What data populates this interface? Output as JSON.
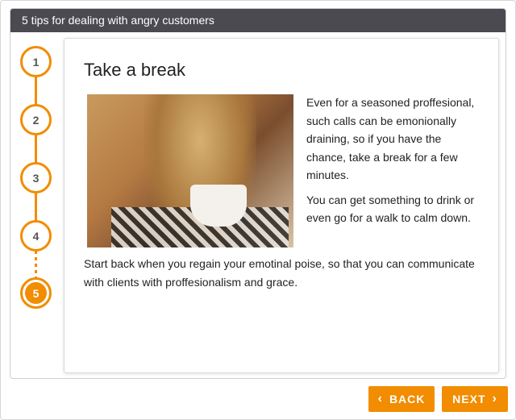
{
  "window": {
    "title": "5 tips for dealing with angry customers"
  },
  "steps": [
    {
      "label": "1",
      "state": "normal"
    },
    {
      "label": "2",
      "state": "normal"
    },
    {
      "label": "3",
      "state": "normal"
    },
    {
      "label": "4",
      "state": "normal"
    },
    {
      "label": "5",
      "state": "active"
    }
  ],
  "content": {
    "heading": "Take a break",
    "image_alt_icon": "photo-woman-drinking-coffee",
    "paragraph1": "Even for a seasoned proffesional, such calls can be emonionally draining, so if you have the chance, take a break for a few minutes.",
    "paragraph2": "You can get something to drink or even go for a walk to calm down.",
    "paragraph3": "Start back when you regain your emotinal poise, so that you can communicate with clients with proffesionalism and grace."
  },
  "nav": {
    "back_label": "BACK",
    "next_label": "NEXT",
    "back_icon": "chevron-left-icon",
    "next_icon": "chevron-right-icon"
  },
  "colors": {
    "accent": "#f28c00",
    "titlebar": "#4b4a50"
  }
}
